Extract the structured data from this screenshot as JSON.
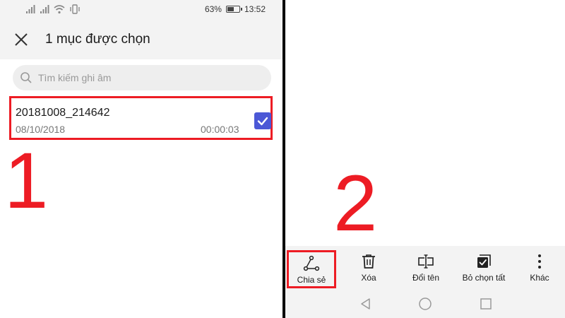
{
  "left_screen": {
    "status_bar": {
      "battery_percent": "63%",
      "battery_level": 0.63,
      "time": "13:52",
      "icons": [
        "signal-icon",
        "signal-icon",
        "wifi-icon",
        "vibrate-icon",
        "battery-icon"
      ]
    },
    "action_bar": {
      "close_icon": "close-icon",
      "title": "1 mục được chọn"
    },
    "search": {
      "placeholder": "Tìm kiếm ghi âm"
    },
    "recordings": [
      {
        "name": "20181008_214642",
        "date": "08/10/2018",
        "duration": "00:00:03",
        "selected": true
      }
    ],
    "step_label": "1"
  },
  "right_screen": {
    "step_label": "2",
    "toolbar": {
      "items": [
        {
          "label": "Chia sẻ",
          "icon": "share-icon"
        },
        {
          "label": "Xóa",
          "icon": "trash-icon"
        },
        {
          "label": "Đổi tên",
          "icon": "rename-icon"
        },
        {
          "label": "Bỏ chọn tất",
          "icon": "deselect-all-icon"
        },
        {
          "label": "Khác",
          "icon": "more-vertical-icon"
        }
      ]
    },
    "nav_bar": {
      "icons": [
        "back-icon",
        "home-icon",
        "recents-icon"
      ]
    }
  },
  "colors": {
    "highlight_red": "#ed1c24",
    "checkbox_blue": "#4b58d6",
    "bar_gray": "#f3f3f3"
  }
}
